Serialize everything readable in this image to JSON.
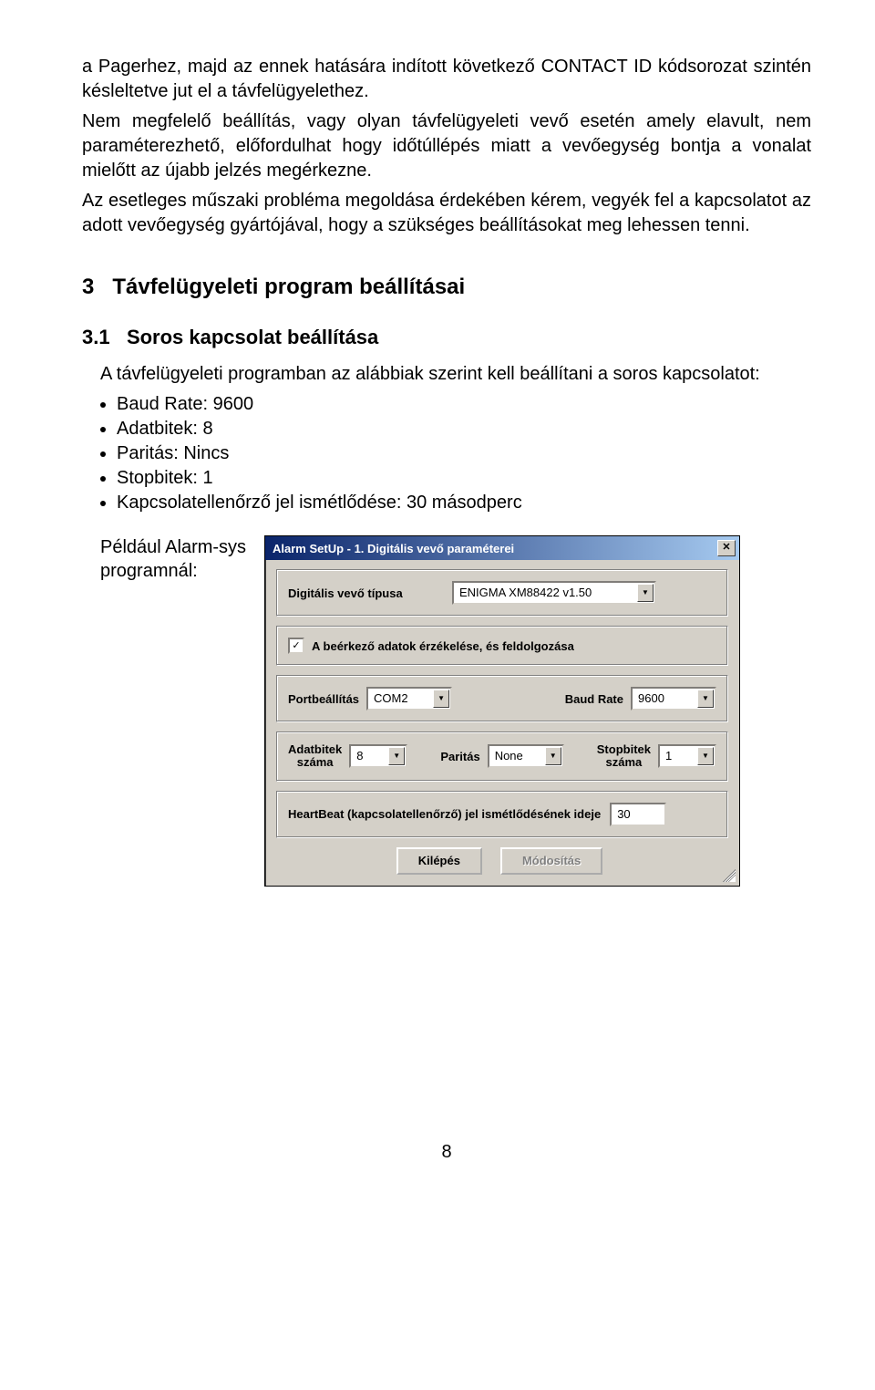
{
  "para1": "a Pagerhez, majd az ennek hatására indított következő CONTACT ID kódsorozat szintén késleltetve jut el a távfelügyelethez.",
  "para2": "Nem megfelelő beállítás, vagy olyan távfelügyeleti vevő esetén amely elavult, nem paraméterezhető, előfordulhat hogy időtúllépés miatt a vevőegység bontja a vonalat mielőtt az újabb jelzés megérkezne.",
  "para3": "Az esetleges műszaki probléma megoldása érdekében kérem, vegyék fel a kapcsolatot az adott vevőegység gyártójával, hogy a szükséges beállításokat meg lehessen tenni.",
  "section3_num": "3",
  "section3_title": "Távfelügyeleti program beállításai",
  "section31_num": "3.1",
  "section31_title": "Soros kapcsolat beállítása",
  "intro31": "A távfelügyeleti programban az alábbiak szerint kell beállítani a soros kapcsolatot:",
  "bullets": [
    "Baud Rate: 9600",
    "Adatbitek: 8",
    "Paritás: Nincs",
    "Stopbitek: 1",
    "Kapcsolatellenőrző jel ismétlődése: 30 másodperc"
  ],
  "example_label": "Például Alarm-sys programnál:",
  "dialog": {
    "title": "Alarm SetUp - 1. Digitális vevő paraméterei",
    "close": "✕",
    "type_label": "Digitális vevő típusa",
    "type_value": "ENIGMA XM88422 v1.50",
    "checkbox_label": "A beérkező adatok érzékelése, és feldolgozása",
    "check_mark": "✓",
    "port_label": "Portbeállítás",
    "port_value": "COM2",
    "baud_label": "Baud Rate",
    "baud_value": "9600",
    "adatbit_label_l1": "Adatbitek",
    "adatbit_label_l2": "száma",
    "adatbit_value": "8",
    "paritas_label": "Paritás",
    "paritas_value": "None",
    "stopbit_label_l1": "Stopbitek",
    "stopbit_label_l2": "száma",
    "stopbit_value": "1",
    "heartbeat_label": "HeartBeat (kapcsolatellenőrző) jel ismétlődésének ideje",
    "heartbeat_value": "30",
    "btn_exit": "Kilépés",
    "btn_modify": "Módosítás",
    "arrow": "▼"
  },
  "page_number": "8"
}
